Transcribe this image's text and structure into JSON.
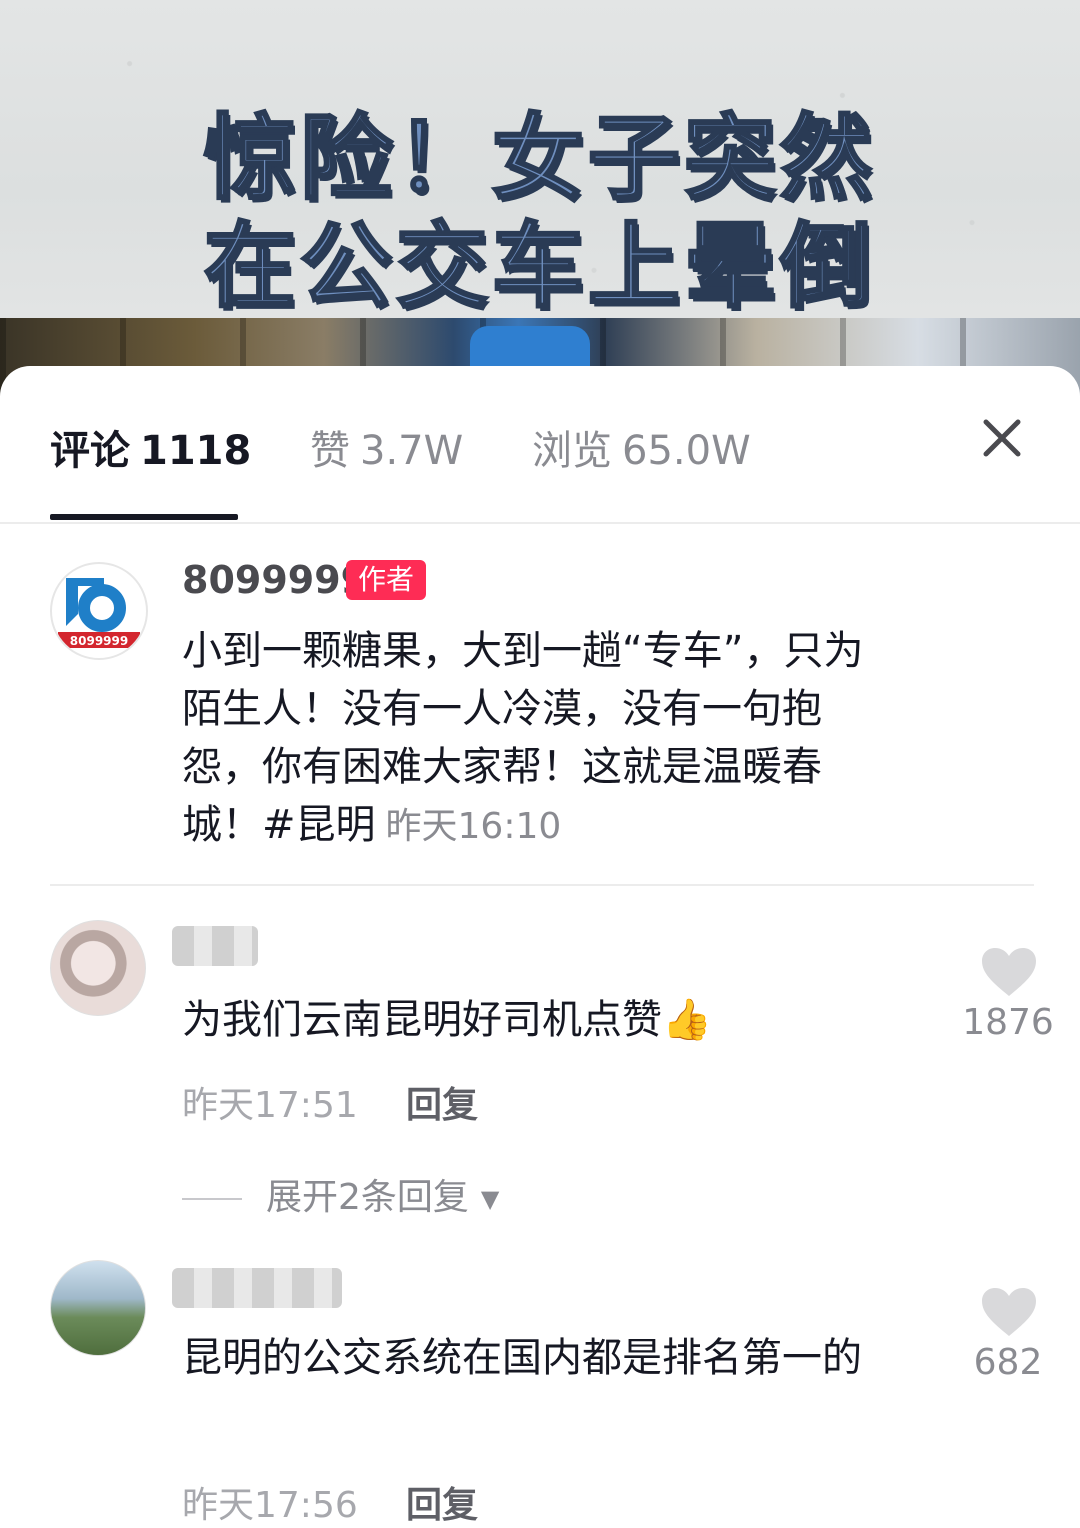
{
  "video": {
    "title_line1": "惊险！女子突然",
    "title_line2": "在公交车上晕倒"
  },
  "tabs": {
    "comments": {
      "label": "评论",
      "count": "1118"
    },
    "likes": {
      "label": "赞",
      "count": "3.7W"
    },
    "views": {
      "label": "浏览",
      "count": "65.0W"
    },
    "close_icon": "close-icon"
  },
  "author_post": {
    "name": "8099999",
    "badge": "作者",
    "logo_text": "8099999",
    "text": "小到一颗糖果，大到一趟“专车”，只为陌生人！没有一人冷漠，没有一句抱怨，你有困难大家帮！这就是温暖春城！#昆明",
    "time": "昨天16:10"
  },
  "comments": [
    {
      "username": "",
      "text": "为我们云南昆明好司机点赞👍",
      "time": "昨天17:51",
      "reply_label": "回复",
      "likes": "1876",
      "expand_label": "展开2条回复"
    },
    {
      "username": "",
      "text": "昆明的公交系统在国内都是排名第一的",
      "time": "昨天17:56",
      "reply_label": "回复",
      "likes": "682"
    }
  ],
  "colors": {
    "accent_badge": "#fe2c55",
    "text_primary": "#161823",
    "text_secondary": "#8a8b91",
    "like_icon": "#d9d9db"
  }
}
